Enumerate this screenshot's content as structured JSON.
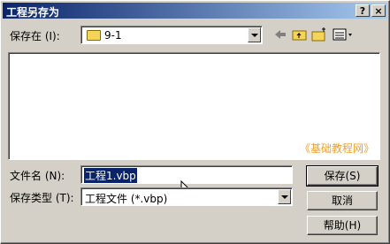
{
  "window": {
    "title": "工程另存为",
    "help_button": "?",
    "close_button": "×"
  },
  "save_in": {
    "label": "保存在 (I):",
    "value": "9-1"
  },
  "watermark": "《基础教程网》",
  "file_name": {
    "label": "文件名 (N):",
    "value": "工程1.vbp"
  },
  "save_type": {
    "label": "保存类型 (T):",
    "value": "工程文件 (*.vbp)"
  },
  "buttons": {
    "save": "保存(S)",
    "cancel": "取消",
    "help": "帮助(H)"
  }
}
